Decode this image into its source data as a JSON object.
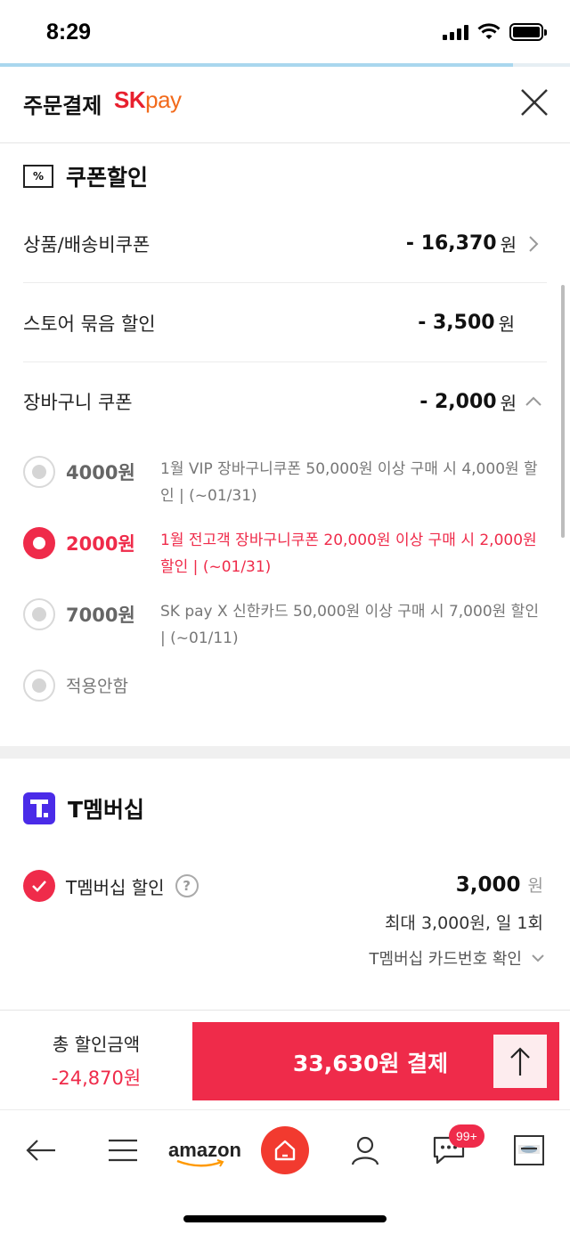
{
  "status_bar": {
    "time": "8:29"
  },
  "header": {
    "title": "주문결제",
    "brand_sk": "SK",
    "brand_pay": "pay"
  },
  "coupon_section": {
    "title": "쿠폰할인",
    "icon_text": "%",
    "rows": [
      {
        "label": "상품/배송비쿠폰",
        "value": "- 16,370",
        "unit": "원"
      },
      {
        "label": "스토어 묶음 할인",
        "value": "- 3,500",
        "unit": "원"
      },
      {
        "label": "장바구니 쿠폰",
        "value": "- 2,000",
        "unit": "원"
      }
    ],
    "cart_options": [
      {
        "amount": "4000원",
        "description": "1월 VIP 장바구니쿠폰 50,000원 이상 구매 시 4,000원 할인 | (~01/31)",
        "selected": false
      },
      {
        "amount": "2000원",
        "description": "1월 전고객 장바구니쿠폰 20,000원 이상 구매 시 2,000원 할인 | (~01/31)",
        "selected": true
      },
      {
        "amount": "7000원",
        "description": "SK pay X 신한카드 50,000원 이상 구매 시 7,000원 할인 | (~01/11)",
        "selected": false
      },
      {
        "label": "적용안함",
        "selected": false
      }
    ]
  },
  "t_membership": {
    "title": "T멤버십",
    "discount_label": "T멤버십 할인",
    "help": "?",
    "amount": "3,000",
    "unit": "원",
    "limit_note": "최대 3,000원, 일 1회",
    "card_check": "T멤버십 카드번호 확인"
  },
  "pay_bar": {
    "total_label": "총 할인금액",
    "total_value": "-24,870원",
    "pay_label": "33,630원 결제"
  },
  "bottom_nav": {
    "amazon_label": "amazon",
    "badge": "99+"
  },
  "colors": {
    "accent": "#ef2b4a",
    "t_membership": "#4a2be8",
    "home": "#f23a2f"
  }
}
